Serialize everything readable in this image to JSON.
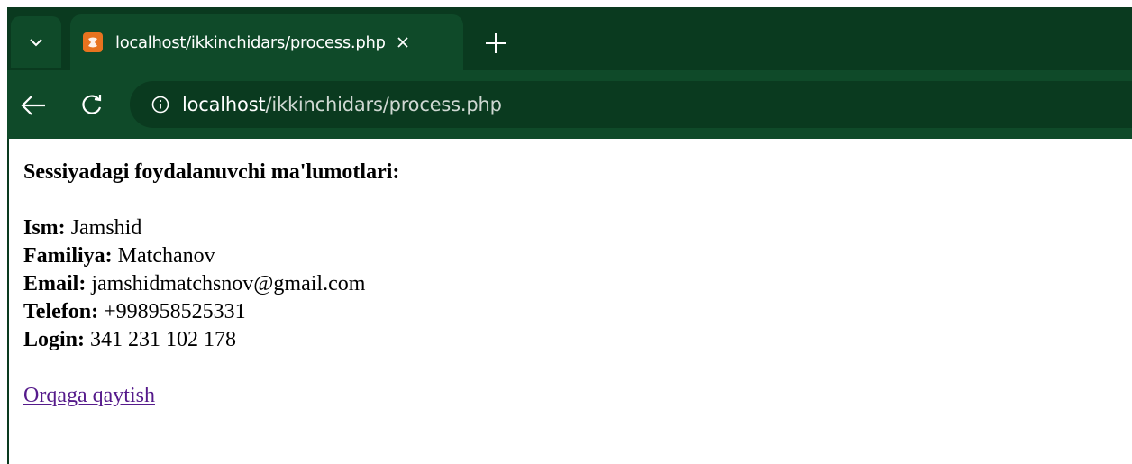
{
  "tab": {
    "title": "localhost/ikkinchidars/process.php",
    "favicon": "xampp-icon"
  },
  "toolbar": {
    "url_host": "localhost",
    "url_path": "/ikkinchidars/process.php"
  },
  "page": {
    "heading": "Sessiyadagi foydalanuvchi ma'lumotlari:",
    "fields": [
      {
        "label": "Ism:",
        "value": "Jamshid"
      },
      {
        "label": "Familiya:",
        "value": "Matchanov"
      },
      {
        "label": "Email:",
        "value": "jamshidmatchsnov@gmail.com"
      },
      {
        "label": "Telefon:",
        "value": "+998958525331"
      },
      {
        "label": "Login:",
        "value": "341 231 102 178"
      }
    ],
    "back_link": "Orqaga qaytish"
  },
  "colors": {
    "chrome_dark": "#0a3a1f",
    "chrome_light": "#0f4a29",
    "visited_link": "#551a8b"
  }
}
